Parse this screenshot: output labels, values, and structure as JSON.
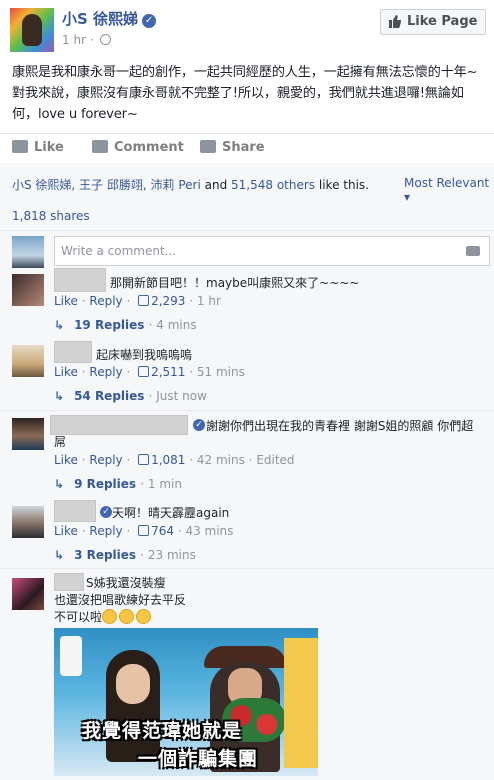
{
  "post": {
    "page_name": "小S 徐熙娣",
    "time": "1 hr",
    "like_page_label": "Like Page",
    "text": "康熙是我和康永哥一起的創作，一起共同經歷的人生，一起擁有無法忘懷的十年~對我來說，康熙沒有康永哥就不完整了!所以，親愛的，我們就共進退囉!無論如何，love u forever~"
  },
  "actions": {
    "like": "Like",
    "comment": "Comment",
    "share": "Share"
  },
  "engagement": {
    "likers_names": "小S 徐熙娣, 王子 邱勝翊, 沛莉 Peri",
    "likers_and": "and",
    "others_count": "51,548 others",
    "likes_suffix": "like this.",
    "sort_label": "Most Relevant",
    "shares": "1,818 shares"
  },
  "composer": {
    "placeholder": "Write a comment..."
  },
  "comments": [
    {
      "text": "那開新節目吧！！maybe叫康熙又來了~~~~",
      "like": "Like",
      "reply": "Reply",
      "likes": "2,293",
      "time": "1 hr",
      "replies": "19 Replies",
      "replies_time": "4 mins"
    },
    {
      "text": "起床嚇到我嗚嗚嗚",
      "like": "Like",
      "reply": "Reply",
      "likes": "2,511",
      "time": "51 mins",
      "replies": "54 Replies",
      "replies_time": "Just now"
    },
    {
      "text_line1": "謝謝你們出現在我的青春裡 謝謝S姐的照顧 你們超",
      "text_line2": "屌",
      "like": "Like",
      "reply": "Reply",
      "likes": "1,081",
      "time": "42 mins",
      "edited": "Edited",
      "replies": "9 Replies",
      "replies_time": "1 min"
    },
    {
      "text": "天啊！晴天霹靂again",
      "like": "Like",
      "reply": "Reply",
      "likes": "764",
      "time": "43 mins",
      "replies": "3 Replies",
      "replies_time": "23 mins"
    },
    {
      "text_line1": "S姊我還沒裝瘦",
      "text_line2": "也還沒把唱歌練好去平反",
      "text_line3": "不可以啦",
      "image_caption_1": "我覺得范瑋她就是",
      "image_caption_2": "一個詐騙集團"
    }
  ],
  "colors": {
    "link": "#365899",
    "muted": "#90949c",
    "accent": "#4267b2",
    "background": "#f6f7f9"
  }
}
